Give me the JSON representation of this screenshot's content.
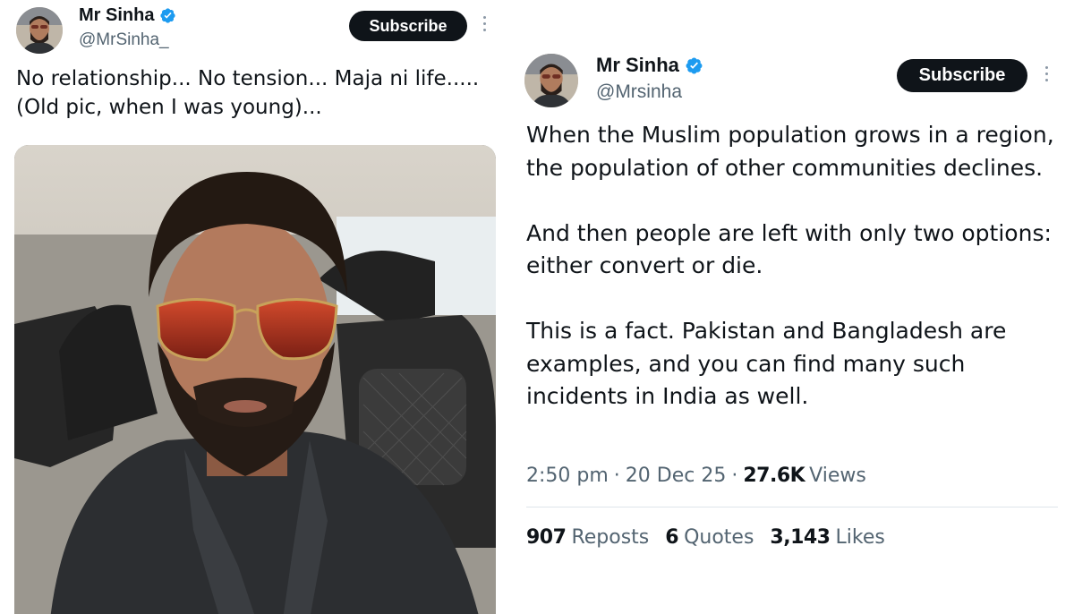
{
  "left_tweet": {
    "display_name": "Mr Sinha",
    "handle": "@MrSinha_",
    "subscribe_label": "Subscribe",
    "text_lines": [
      "No relationship... No tension... Maja ni life.....",
      "(Old pic, when I was young)..."
    ]
  },
  "right_tweet": {
    "display_name": "Mr Sinha",
    "handle": "@Mrsinha",
    "subscribe_label": "Subscribe",
    "paragraphs": [
      "When the Muslim population grows in a region, the population of other communities declines.",
      "And then people are left with only two options: either convert or die.",
      "This is a fact. Pakistan and Bangladesh are examples, and you can find many such incidents in India as well."
    ],
    "meta": {
      "time": "2:50 pm",
      "separator": "·",
      "date": "20 Dec 25",
      "views_count": "27.6K",
      "views_label": "Views"
    },
    "stats": [
      {
        "count": "907",
        "label": "Reposts"
      },
      {
        "count": "6",
        "label": "Quotes"
      },
      {
        "count": "3,143",
        "label": "Likes"
      }
    ]
  },
  "colors": {
    "verified": "#1d9bf0",
    "button_bg": "#0f1419",
    "secondary_text": "#536471"
  },
  "icons": [
    "verified-badge-icon",
    "more-options-icon"
  ]
}
